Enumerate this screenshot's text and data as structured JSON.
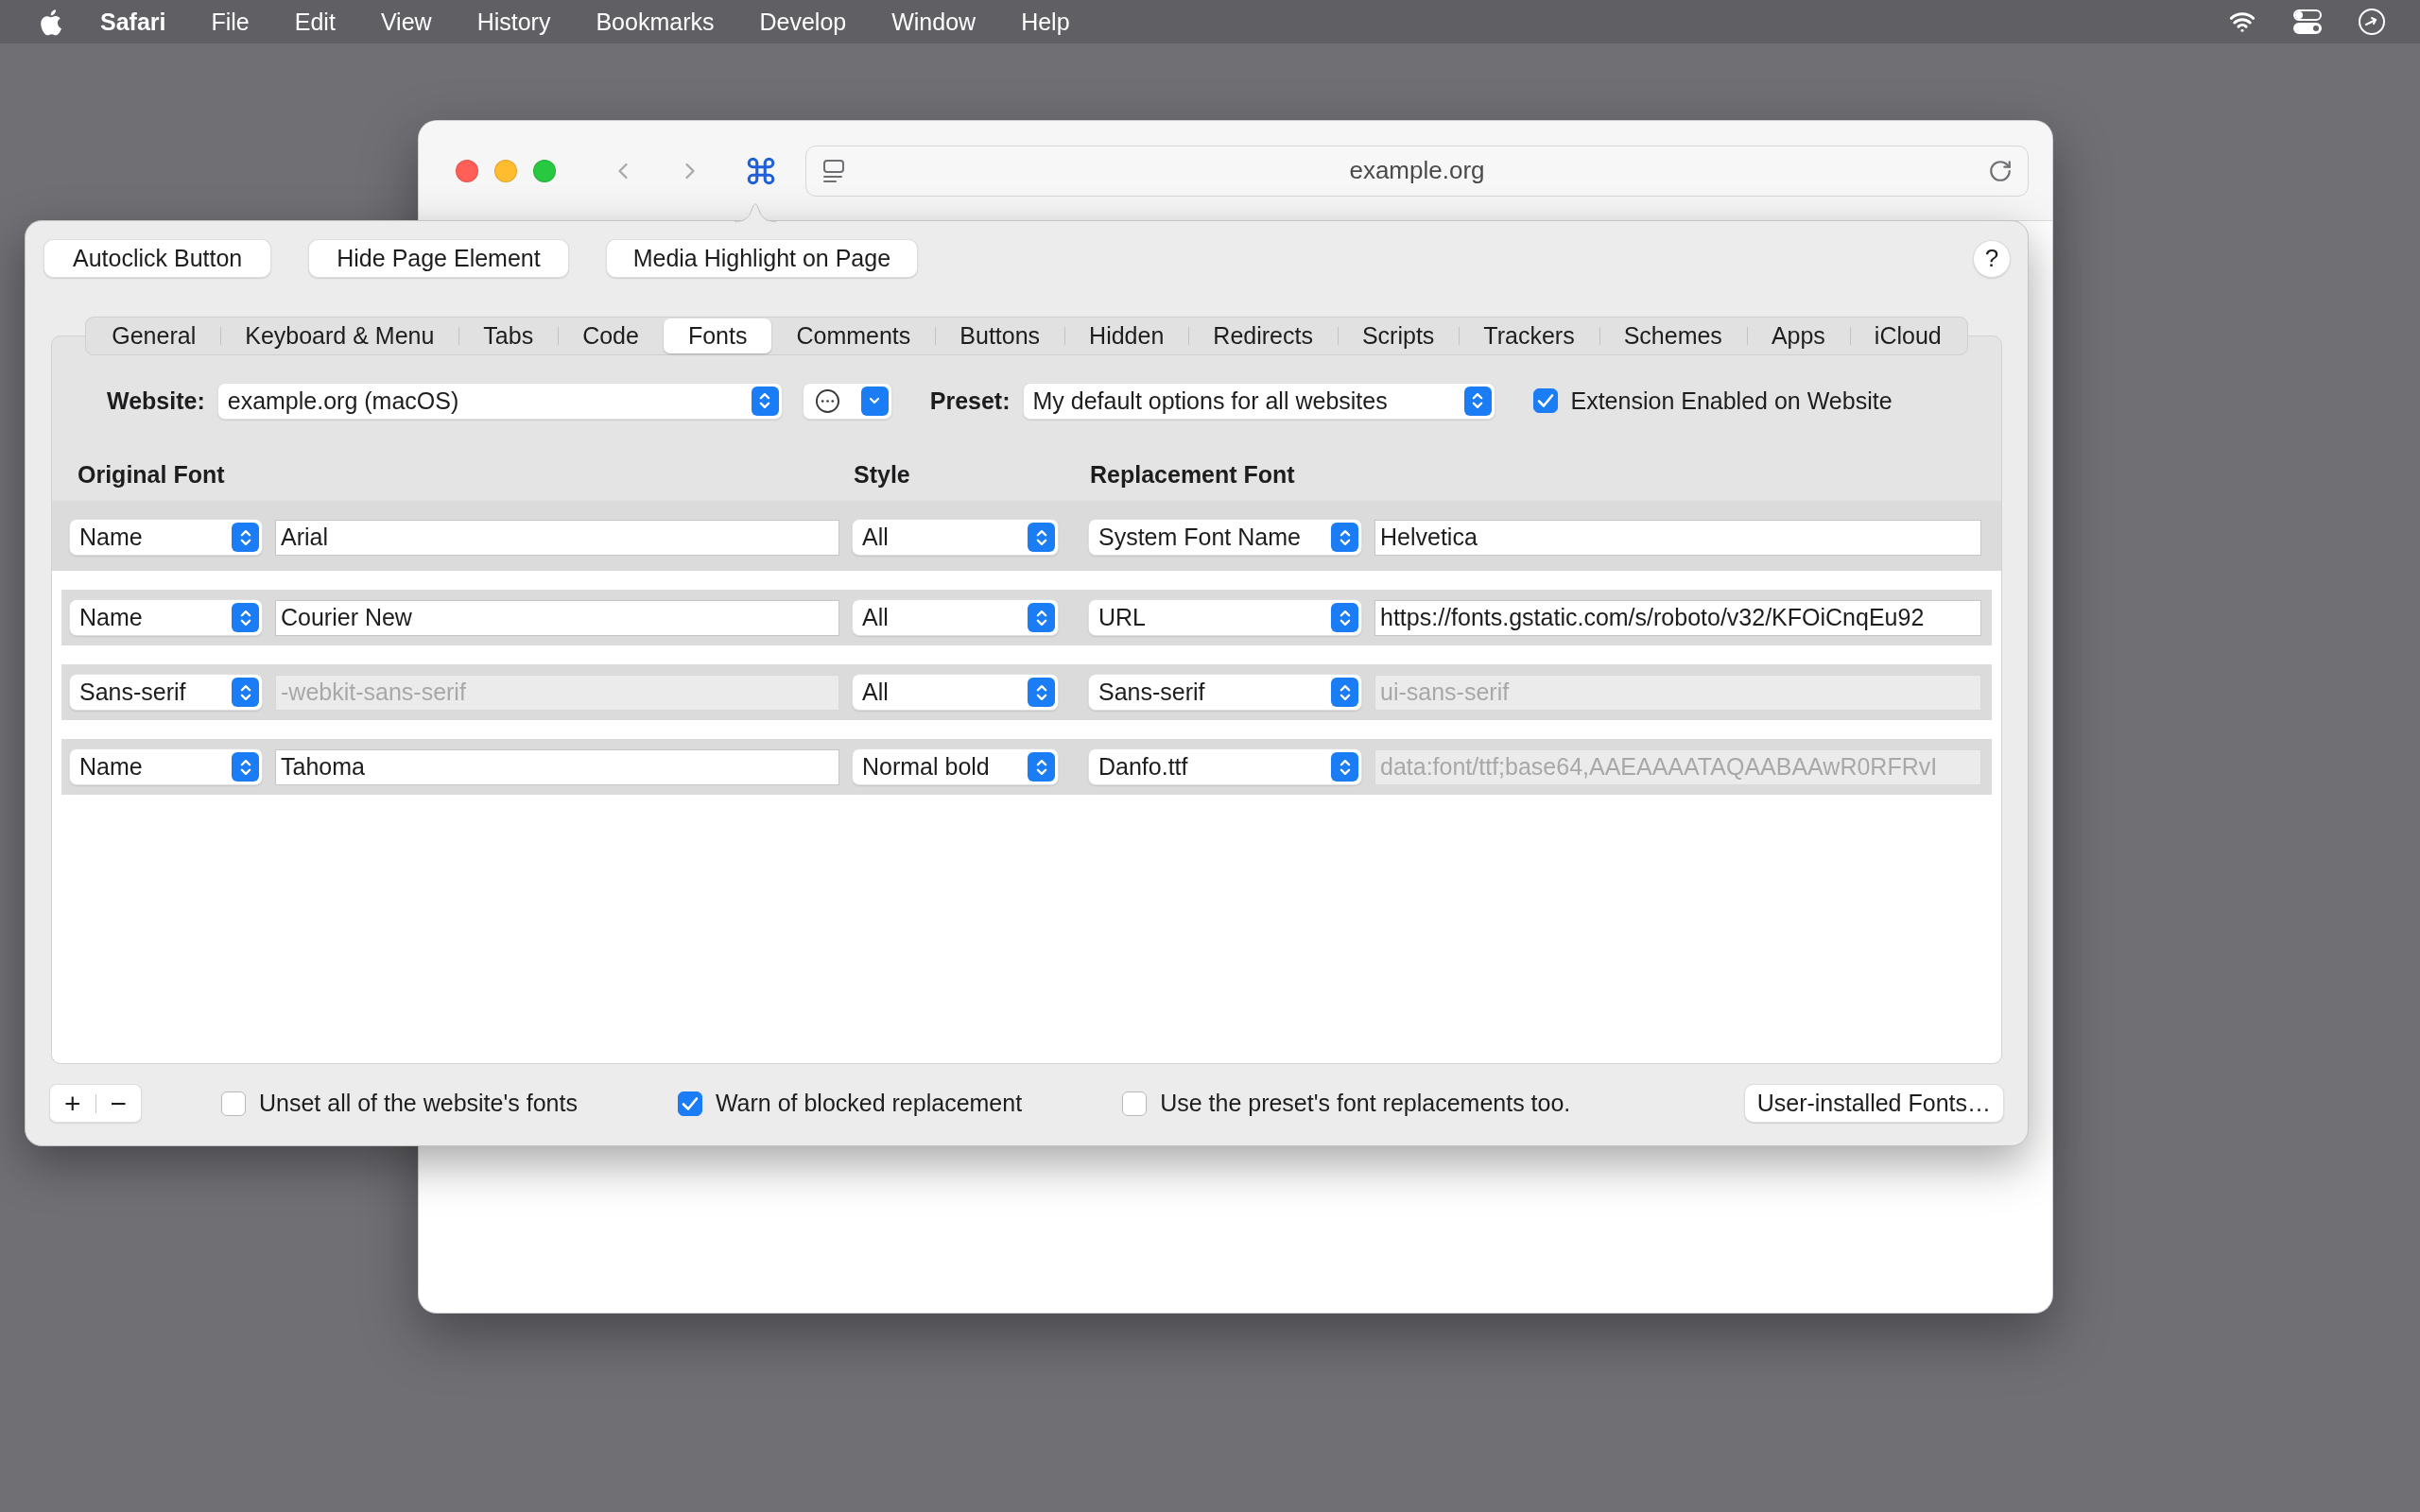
{
  "menu_bar": {
    "app_name": "Safari",
    "items": [
      "File",
      "Edit",
      "View",
      "History",
      "Bookmarks",
      "Develop",
      "Window",
      "Help"
    ]
  },
  "browser": {
    "address": "example.org"
  },
  "popup": {
    "action_buttons": [
      "Autoclick Button",
      "Hide Page Element",
      "Media Highlight on Page"
    ],
    "help_button": "?",
    "tabs": [
      {
        "label": "General",
        "selected": false
      },
      {
        "label": "Keyboard & Menu",
        "selected": false
      },
      {
        "label": "Tabs",
        "selected": false
      },
      {
        "label": "Code",
        "selected": false
      },
      {
        "label": "Fonts",
        "selected": true
      },
      {
        "label": "Comments",
        "selected": false
      },
      {
        "label": "Buttons",
        "selected": false
      },
      {
        "label": "Hidden",
        "selected": false
      },
      {
        "label": "Redirects",
        "selected": false
      },
      {
        "label": "Scripts",
        "selected": false
      },
      {
        "label": "Trackers",
        "selected": false
      },
      {
        "label": "Schemes",
        "selected": false
      },
      {
        "label": "Apps",
        "selected": false
      },
      {
        "label": "iCloud",
        "selected": false
      }
    ],
    "website": {
      "label": "Website:",
      "value": "example.org (macOS)"
    },
    "preset": {
      "label": "Preset:",
      "value": "My default options for all websites"
    },
    "extension_enabled": {
      "label": "Extension Enabled on Website",
      "checked": true
    },
    "columns": [
      "Original Font",
      "Style",
      "Replacement Font"
    ],
    "rows": [
      {
        "selected": true,
        "match_by": "Name",
        "original_font": {
          "value": "Arial",
          "disabled": false
        },
        "style": "All",
        "replacement_type": "System Font Name",
        "replacement_font": {
          "value": "Helvetica",
          "disabled": false
        }
      },
      {
        "selected": false,
        "match_by": "Name",
        "original_font": {
          "value": "Courier New",
          "disabled": false
        },
        "style": "All",
        "replacement_type": "URL",
        "replacement_font": {
          "value": "https://fonts.gstatic.com/s/roboto/v32/KFOiCnqEu92",
          "disabled": false
        }
      },
      {
        "selected": false,
        "match_by": "Sans-serif",
        "original_font": {
          "value": "-webkit-sans-serif",
          "disabled": true
        },
        "style": "All",
        "replacement_type": "Sans-serif",
        "replacement_font": {
          "value": "ui-sans-serif",
          "disabled": true
        }
      },
      {
        "selected": false,
        "match_by": "Name",
        "original_font": {
          "value": "Tahoma",
          "disabled": false
        },
        "style": "Normal bold",
        "replacement_type": "Danfo.ttf",
        "replacement_font": {
          "value": "data:font/ttf;base64,AAEAAAATAQAABAAwR0RFRvI",
          "disabled": true
        }
      }
    ],
    "add_button": "+",
    "remove_button": "−",
    "options": [
      {
        "label": "Unset all of the website's fonts",
        "checked": false
      },
      {
        "label": "Warn of blocked replacement",
        "checked": true
      },
      {
        "label": "Use the preset's font replacements too.",
        "checked": false
      }
    ],
    "fonts_button": "User-installed Fonts…"
  }
}
